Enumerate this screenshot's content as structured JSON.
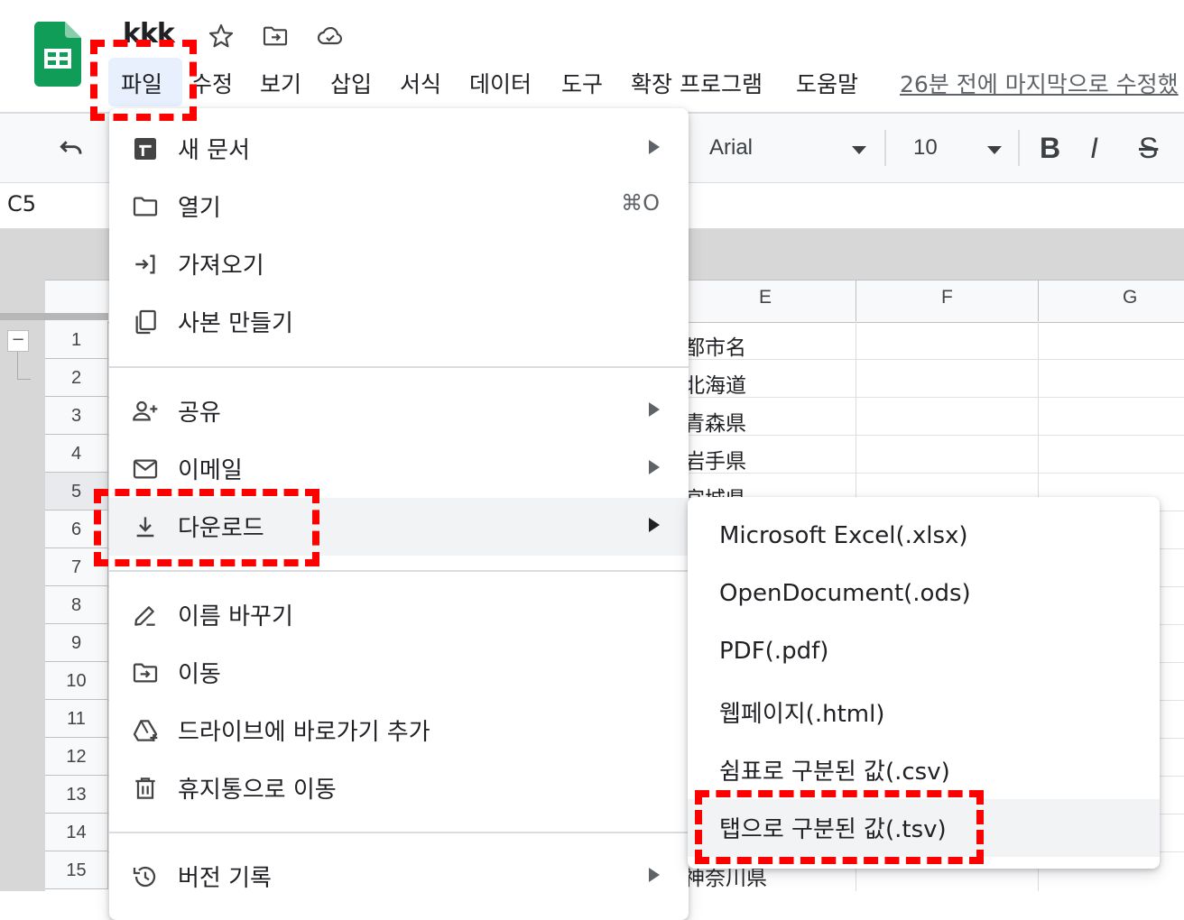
{
  "app": {
    "doc_title": "kkk",
    "last_edit": "26분 전에 마지막으로 수정했"
  },
  "menubar": {
    "items": [
      "파일",
      "수정",
      "보기",
      "삽입",
      "서식",
      "데이터",
      "도구",
      "확장 프로그램",
      "도움말"
    ]
  },
  "toolbar": {
    "font_name": "Arial",
    "font_size": "10",
    "bold": "B",
    "italic": "I",
    "strike": "S"
  },
  "formula_bar": {
    "name_box": "C5"
  },
  "grid": {
    "columns": [
      "E",
      "F",
      "G"
    ],
    "rows": [
      "1",
      "2",
      "3",
      "4",
      "5",
      "6",
      "7",
      "8",
      "9",
      "10",
      "11",
      "12",
      "13",
      "14",
      "15"
    ],
    "cells_col_e": [
      "都市名",
      "北海道",
      "青森県",
      "岩手県",
      "宮城県",
      "神奈川県"
    ]
  },
  "file_menu": {
    "items": [
      {
        "label": "새 문서",
        "icon": "new-sheet-icon",
        "arrow": true
      },
      {
        "label": "열기",
        "icon": "folder-icon",
        "shortcut": "⌘O"
      },
      {
        "label": "가져오기",
        "icon": "import-icon"
      },
      {
        "label": "사본 만들기",
        "icon": "copy-icon"
      },
      {
        "label": "공유",
        "icon": "share-person-icon",
        "arrow": true
      },
      {
        "label": "이메일",
        "icon": "mail-icon",
        "arrow": true
      },
      {
        "label": "다운로드",
        "icon": "download-icon",
        "arrow": true,
        "highlighted": true
      },
      {
        "label": "이름 바꾸기",
        "icon": "rename-pen-icon"
      },
      {
        "label": "이동",
        "icon": "move-folder-icon"
      },
      {
        "label": "드라이브에 바로가기 추가",
        "icon": "drive-shortcut-icon"
      },
      {
        "label": "휴지통으로 이동",
        "icon": "trash-icon"
      },
      {
        "label": "버전 기록",
        "icon": "history-icon",
        "arrow": true
      }
    ]
  },
  "download_submenu": {
    "items": [
      {
        "label": "Microsoft Excel(.xlsx)"
      },
      {
        "label": "OpenDocument(.ods)"
      },
      {
        "label": "PDF(.pdf)"
      },
      {
        "label": "웹페이지(.html)"
      },
      {
        "label": "쉼표로 구분된 값(.csv)"
      },
      {
        "label": "탭으로 구분된 값(.tsv)",
        "highlighted": true
      }
    ]
  },
  "colors": {
    "sheets_green": "#0f9d58",
    "menu_highlight": "#f1f3f4",
    "annotation_red": "#ff0000"
  }
}
